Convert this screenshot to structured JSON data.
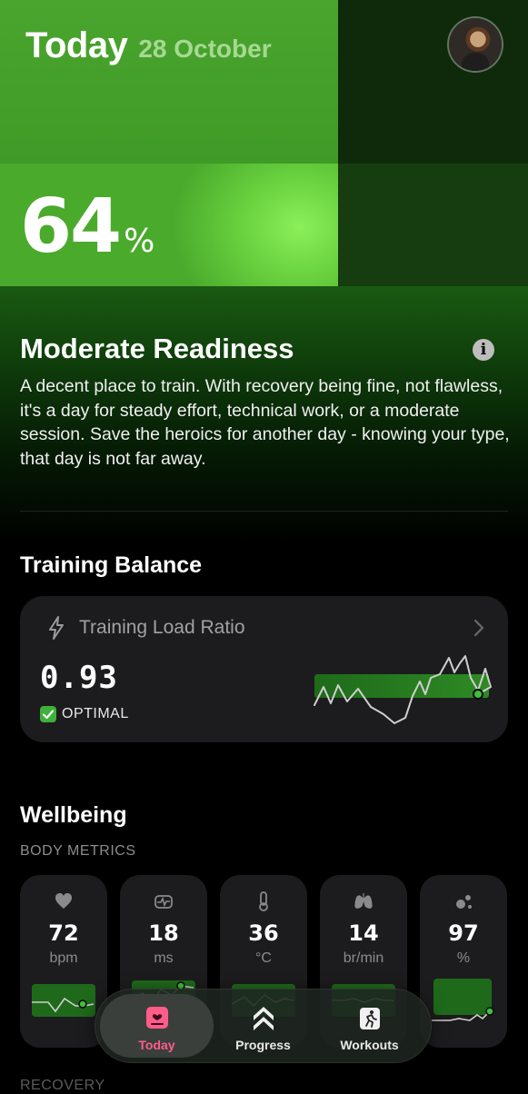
{
  "header": {
    "title": "Today",
    "date": "28 October"
  },
  "readiness": {
    "score": "64",
    "unit": "%",
    "title": "Moderate Readiness",
    "description": "A decent place to train. With recovery being fine, not flawless, it's a day for steady effort, technical work, or a moderate session. Save the heroics for another day - knowing your type, that day is not far away."
  },
  "training_balance": {
    "section_title": "Training Balance",
    "card": {
      "label": "Training Load Ratio",
      "value": "0.93",
      "status": "OPTIMAL"
    }
  },
  "wellbeing": {
    "section_title": "Wellbeing",
    "subtitle": "BODY METRICS",
    "metrics": [
      {
        "icon": "heart-icon",
        "value": "72",
        "unit": "bpm"
      },
      {
        "icon": "waveform-icon",
        "value": "18",
        "unit": "ms"
      },
      {
        "icon": "thermometer-icon",
        "value": "36",
        "unit": "°C"
      },
      {
        "icon": "lungs-icon",
        "value": "14",
        "unit": "br/min"
      },
      {
        "icon": "oxygen-icon",
        "value": "97",
        "unit": "%"
      }
    ]
  },
  "tabbar": {
    "tabs": [
      {
        "label": "Today",
        "icon": "today-icon",
        "active": true
      },
      {
        "label": "Progress",
        "icon": "progress-chevrons-icon",
        "active": false
      },
      {
        "label": "Workouts",
        "icon": "workouts-icon",
        "active": false
      }
    ]
  },
  "recovery_label": "RECOVERY",
  "colors": {
    "accent_green": "#3fb03a",
    "tab_active": "#ff5c8a",
    "card_bg": "#1c1c1e"
  }
}
